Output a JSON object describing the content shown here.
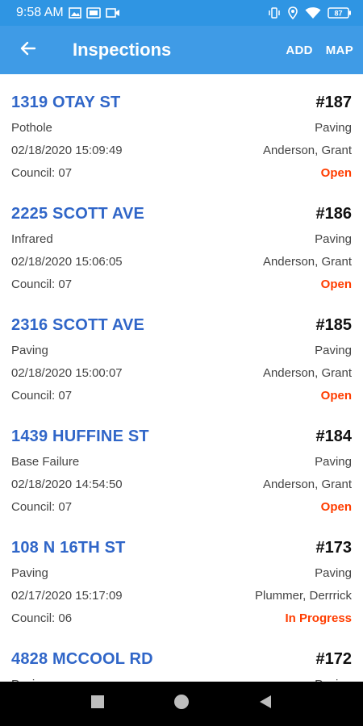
{
  "status_bar": {
    "time": "9:58 AM",
    "battery": "87",
    "icons": [
      "image-icon",
      "photo-icon",
      "video-icon",
      "vibrate-icon",
      "location-icon",
      "wifi-icon",
      "battery-icon"
    ]
  },
  "appbar": {
    "title": "Inspections",
    "add_label": "ADD",
    "map_label": "MAP",
    "color": "#3f9be6"
  },
  "colors": {
    "address": "#3066c8",
    "status_open": "#ff3d00",
    "status_in_progress": "#ff3d00"
  },
  "inspections": [
    {
      "address": "1319 OTAY ST",
      "number": "#187",
      "type": "Pothole",
      "category": "Paving",
      "datetime": "02/18/2020 15:09:49",
      "inspector": "Anderson, Grant",
      "council": "Council:  07",
      "status": "Open"
    },
    {
      "address": "2225 SCOTT AVE",
      "number": "#186",
      "type": "Infrared",
      "category": "Paving",
      "datetime": "02/18/2020 15:06:05",
      "inspector": "Anderson, Grant",
      "council": "Council:  07",
      "status": "Open"
    },
    {
      "address": "2316 SCOTT AVE",
      "number": "#185",
      "type": "Paving",
      "category": "Paving",
      "datetime": "02/18/2020 15:00:07",
      "inspector": "Anderson, Grant",
      "council": "Council:  07",
      "status": "Open"
    },
    {
      "address": "1439 HUFFINE ST",
      "number": "#184",
      "type": "Base Failure",
      "category": "Paving",
      "datetime": "02/18/2020 14:54:50",
      "inspector": "Anderson, Grant",
      "council": "Council:  07",
      "status": "Open"
    },
    {
      "address": "108 N 16TH ST",
      "number": "#173",
      "type": "Paving",
      "category": "Paving",
      "datetime": "02/17/2020 15:17:09",
      "inspector": "Plummer, Derrrick",
      "council": "Council:  06",
      "status": "In Progress"
    },
    {
      "address": "4828 MCCOOL RD",
      "number": "#172",
      "type": "Paving",
      "category": "Paving",
      "datetime": "",
      "inspector": "",
      "council": "",
      "status": ""
    }
  ]
}
